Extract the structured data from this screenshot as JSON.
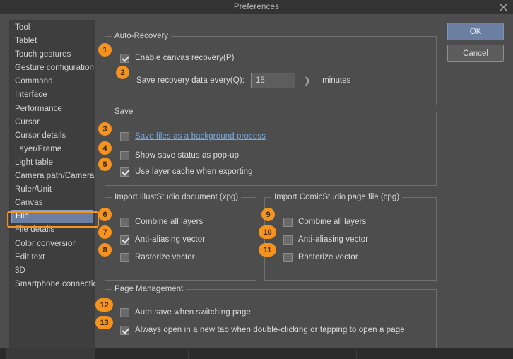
{
  "window": {
    "title": "Preferences",
    "close_icon": "close-icon"
  },
  "buttons": {
    "ok": "OK",
    "cancel": "Cancel"
  },
  "sidebar": {
    "items": [
      {
        "label": "Tool",
        "selected": false
      },
      {
        "label": "Tablet",
        "selected": false
      },
      {
        "label": "Touch gestures",
        "selected": false
      },
      {
        "label": "Gesture configuration",
        "selected": false
      },
      {
        "label": "Command",
        "selected": false
      },
      {
        "label": "Interface",
        "selected": false
      },
      {
        "label": "Performance",
        "selected": false
      },
      {
        "label": "Cursor",
        "selected": false
      },
      {
        "label": "Cursor details",
        "selected": false
      },
      {
        "label": "Layer/Frame",
        "selected": false
      },
      {
        "label": "Light table",
        "selected": false
      },
      {
        "label": "Camera path/Camera",
        "selected": false
      },
      {
        "label": "Ruler/Unit",
        "selected": false
      },
      {
        "label": "Canvas",
        "selected": false
      },
      {
        "label": "File",
        "selected": true
      },
      {
        "label": "File details",
        "selected": false
      },
      {
        "label": "Color conversion",
        "selected": false
      },
      {
        "label": "Edit text",
        "selected": false
      },
      {
        "label": "3D",
        "selected": false
      },
      {
        "label": "Smartphone connection",
        "selected": false
      }
    ]
  },
  "groups": {
    "auto_recovery": {
      "title": "Auto-Recovery",
      "enable_canvas_recovery": {
        "badge": "1",
        "label": "Enable canvas recovery(P)",
        "checked": true
      },
      "save_recovery": {
        "badge": "2",
        "label": "Save recovery data every(Q):",
        "value": "15",
        "stepper_icon": "chevron-right-icon",
        "unit": "minutes"
      }
    },
    "save": {
      "title": "Save",
      "rows": [
        {
          "badge": "3",
          "label": "Save files as a background process",
          "checked": false,
          "link": true
        },
        {
          "badge": "4",
          "label": "Show save status as pop-up",
          "checked": false,
          "link": false
        },
        {
          "badge": "5",
          "label": "Use layer cache when exporting",
          "checked": true,
          "link": false
        }
      ]
    },
    "import_xpg": {
      "title": "Import IllustStudio document (xpg)",
      "rows": [
        {
          "badge": "6",
          "label": "Combine all layers",
          "checked": false
        },
        {
          "badge": "7",
          "label": "Anti-aliasing vector",
          "checked": true
        },
        {
          "badge": "8",
          "label": "Rasterize vector",
          "checked": false
        }
      ]
    },
    "import_cpg": {
      "title": "Import ComicStudio page file (cpg)",
      "rows": [
        {
          "badge": "9",
          "label": "Combine all layers",
          "checked": false
        },
        {
          "badge": "10",
          "label": "Anti-aliasing vector",
          "checked": false
        },
        {
          "badge": "11",
          "label": "Rasterize vector",
          "checked": false
        }
      ]
    },
    "page_management": {
      "title": "Page Management",
      "rows": [
        {
          "badge": "12",
          "label": "Auto save when switching page",
          "checked": false
        },
        {
          "badge": "13",
          "label": "Always open in a new tab when double-clicking or tapping to open a page",
          "checked": true
        }
      ]
    }
  },
  "colors": {
    "accent_badge": "#f6921e",
    "selection": "#6b7fa3",
    "link": "#7aa7dd",
    "window_bg": "#4d4d4d",
    "titlebar_bg": "#333333"
  }
}
